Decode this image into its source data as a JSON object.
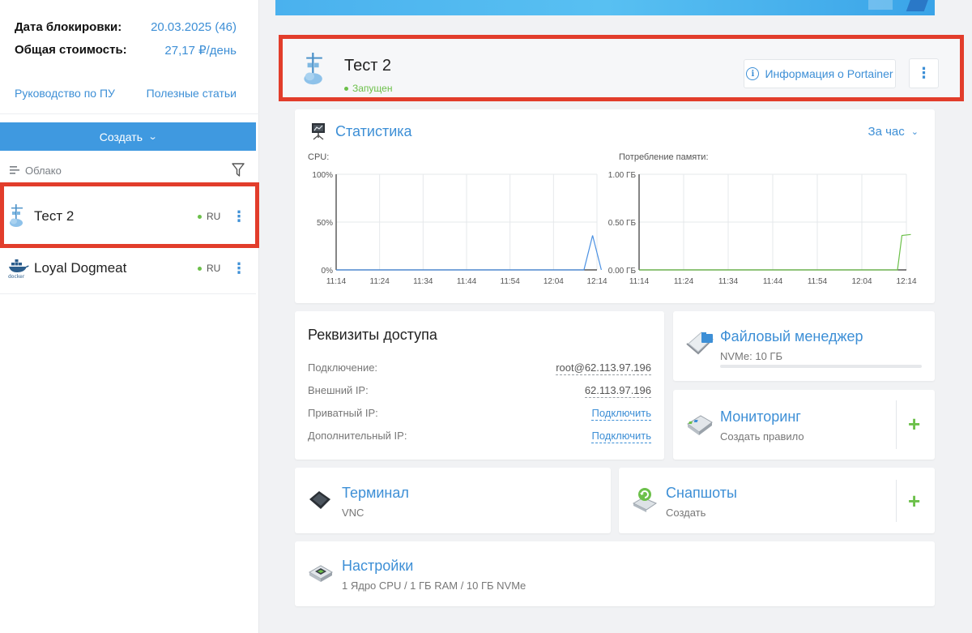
{
  "sidebar": {
    "block_date_label": "Дата блокировки:",
    "block_date_value": "20.03.2025 (46)",
    "total_cost_label": "Общая стоимость:",
    "total_cost_value": "27,17 ₽/день",
    "link_manual": "Руководство по ПУ",
    "link_articles": "Полезные статьи",
    "create_label": "Создать",
    "group_label": "Облако",
    "servers": [
      {
        "name": "Тест 2",
        "region": "RU"
      },
      {
        "name": "Loyal Dogmeat",
        "region": "RU"
      }
    ],
    "docker_text": "docker"
  },
  "header": {
    "title": "Тест 2",
    "status": "Запущен",
    "portainer_label": "Информация о Portainer",
    "kebab": "⋮"
  },
  "stats": {
    "title": "Статистика",
    "period": "За час"
  },
  "chart_data": [
    {
      "type": "line",
      "title": "CPU:",
      "x": [
        "11:14",
        "11:24",
        "11:34",
        "11:44",
        "11:54",
        "12:04",
        "12:14"
      ],
      "y_ticks": [
        "0%",
        "50%",
        "100%"
      ],
      "ylim": [
        0,
        100
      ],
      "series": [
        {
          "values": [
            [
              0,
              0
            ],
            [
              10,
              0
            ],
            [
              20,
              0
            ],
            [
              30,
              0
            ],
            [
              40,
              0
            ],
            [
              50,
              0
            ],
            [
              57,
              0
            ],
            [
              59,
              36
            ],
            [
              61,
              0
            ]
          ],
          "color": "#4a90e2"
        }
      ]
    },
    {
      "type": "line",
      "title": "Потребление памяти:",
      "x": [
        "11:14",
        "11:24",
        "11:34",
        "11:44",
        "11:54",
        "12:04",
        "12:14"
      ],
      "y_ticks": [
        "0.00 ГБ",
        "0.50 ГБ",
        "1.00 ГБ"
      ],
      "ylim": [
        0,
        1
      ],
      "series": [
        {
          "values": [
            [
              0,
              0
            ],
            [
              10,
              0
            ],
            [
              20,
              0
            ],
            [
              30,
              0
            ],
            [
              40,
              0
            ],
            [
              50,
              0
            ],
            [
              58,
              0
            ],
            [
              59,
              0.36
            ],
            [
              61,
              0.37
            ]
          ],
          "color": "#6cc04a"
        }
      ]
    }
  ],
  "access": {
    "title": "Реквизиты доступа",
    "rows": [
      {
        "label": "Подключение:",
        "value": "root@62.113.97.196"
      },
      {
        "label": "Внешний IP:",
        "value": "62.113.97.196"
      },
      {
        "label": "Приватный IP:",
        "value": "Подключить"
      },
      {
        "label": "Дополнительный IP:",
        "value": "Подключить"
      }
    ]
  },
  "files": {
    "title": "Файловый менеджер",
    "sub": "NVMe: 10 ГБ",
    "used_fraction": 0.0
  },
  "monitoring": {
    "title": "Мониторинг",
    "sub": "Создать правило",
    "plus": "+"
  },
  "terminal": {
    "title": "Терминал",
    "sub": "VNC"
  },
  "snapshots": {
    "title": "Снапшоты",
    "sub": "Создать",
    "plus": "+"
  },
  "settings": {
    "title": "Настройки",
    "sub": "1 Ядро CPU / 1 ГБ RAM / 10 ГБ NVMe"
  }
}
